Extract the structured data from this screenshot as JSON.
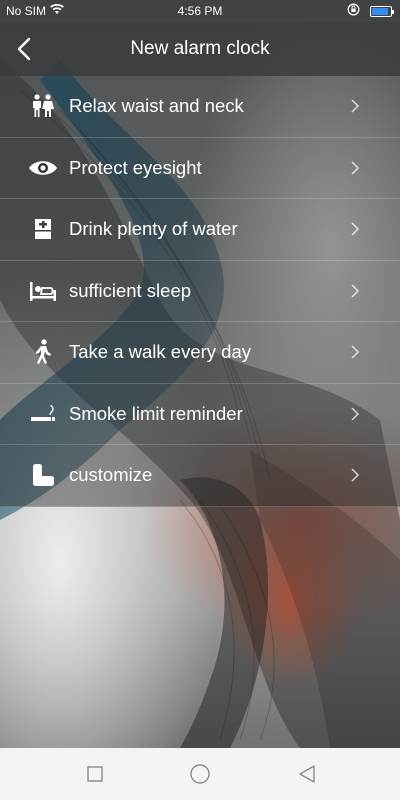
{
  "status_bar": {
    "carrier": "No SIM",
    "time": "4:56 PM",
    "battery_percent": 90,
    "icons": [
      "wifi-icon",
      "rotation-lock-icon",
      "battery-icon"
    ],
    "battery_color": "#2f8df5"
  },
  "header": {
    "title": "New alarm clock",
    "back_icon": "back-arrow-icon"
  },
  "list": {
    "items": [
      {
        "label": "Relax waist and neck",
        "icon": "people-icon"
      },
      {
        "label": "Protect eyesight",
        "icon": "eye-icon"
      },
      {
        "label": "Drink plenty of water",
        "icon": "water-dispenser-icon"
      },
      {
        "label": "sufficient sleep",
        "icon": "bed-icon"
      },
      {
        "label": "Take a walk every day",
        "icon": "walking-person-icon"
      },
      {
        "label": "Smoke limit reminder",
        "icon": "cigarette-icon"
      },
      {
        "label": "customize",
        "icon": "customize-icon"
      }
    ],
    "trailing_icon": "chevron-right-icon"
  },
  "nav_bar": {
    "buttons": [
      "recents-square-icon",
      "home-circle-icon",
      "back-triangle-icon"
    ]
  }
}
